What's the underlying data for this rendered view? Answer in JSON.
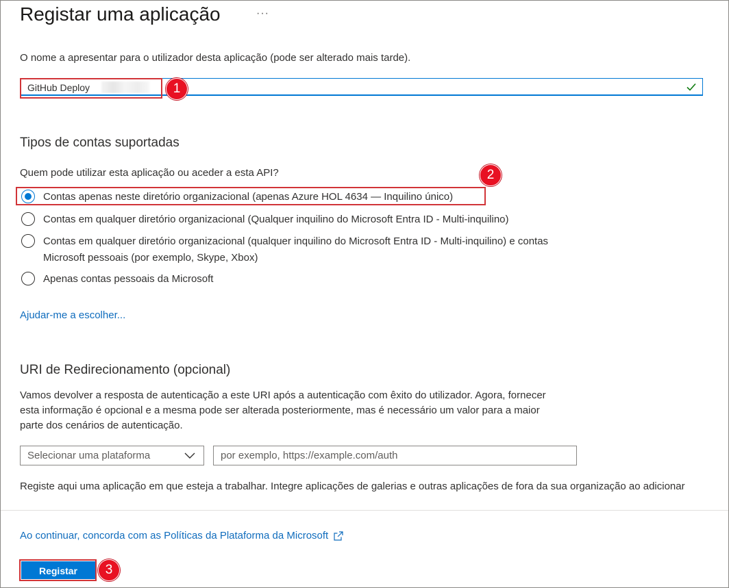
{
  "header": {
    "title": "Registar uma aplicação",
    "more_label": "···"
  },
  "name_section": {
    "description": "O nome a apresentar para o utilizador desta aplicação (pode ser alterado mais tarde).",
    "input_value": "GitHub Deploy",
    "valid_icon": "checkmark-icon",
    "step_badge": "1"
  },
  "account_types": {
    "heading": "Tipos de contas suportadas",
    "question": "Quem pode utilizar esta aplicação ou aceder a esta API?",
    "step_badge": "2",
    "options": [
      {
        "label": "Contas apenas neste diretório organizacional (apenas Azure HOL 4634 — Inquilino único)",
        "selected": true
      },
      {
        "label": "Contas em qualquer diretório organizacional (Qualquer inquilino do Microsoft Entra ID - Multi-inquilino)",
        "selected": false
      },
      {
        "label_line1": "Contas em qualquer diretório organizacional (qualquer inquilino do Microsoft Entra ID - Multi-inquilino) e contas",
        "label_line2": "Microsoft pessoais (por exemplo, Skype, Xbox)",
        "selected": false
      },
      {
        "label": "Apenas contas pessoais da Microsoft",
        "selected": false
      }
    ],
    "help_link": "Ajudar-me a escolher..."
  },
  "redirect": {
    "heading": "URI de Redirecionamento (opcional)",
    "description_lines": [
      "Vamos devolver a resposta de autenticação a este URI após a autenticação com êxito do utilizador. Agora, fornecer",
      "esta informação é opcional e a mesma pode ser alterada posteriormente, mas é necessário um valor para a maior",
      "parte dos cenários de autenticação."
    ],
    "platform_select": "Selecionar uma plataforma",
    "uri_placeholder": "por exemplo, https://example.com/auth"
  },
  "note": "Registe aqui uma aplicação em que esteja a trabalhar. Integre aplicações de galerias e outras aplicações de fora da sua organização ao adicionar",
  "footer": {
    "policy_link": "Ao continuar, concorda com as Políticas da Plataforma da Microsoft",
    "register_button": "Registar",
    "step_badge": "3"
  },
  "colors": {
    "accent": "#0078d4",
    "link": "#0f6cbd",
    "highlight": "#d13438",
    "badge": "#e81123",
    "valid": "#107c10"
  }
}
